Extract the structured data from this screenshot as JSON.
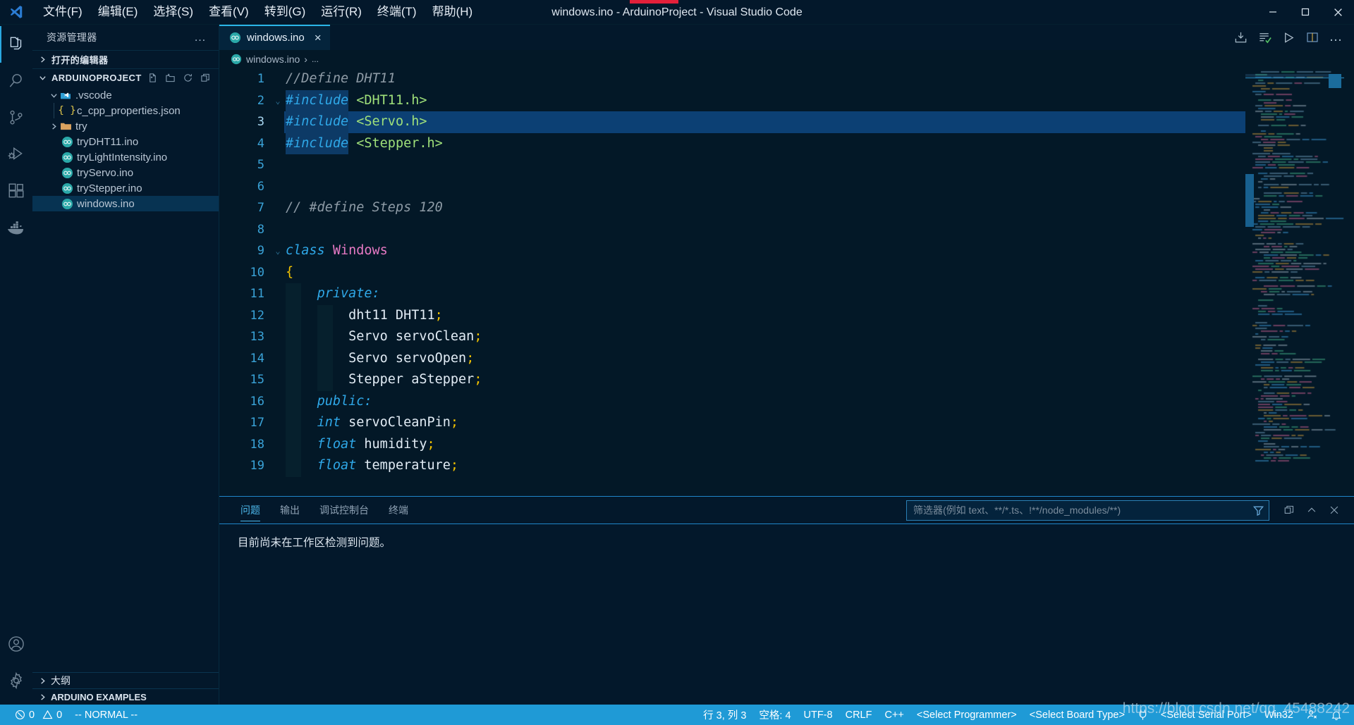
{
  "titlebar": {
    "app_title": "windows.ino - ArduinoProject - Visual Studio Code",
    "menu": [
      {
        "label": "文件(F)",
        "name": "menu-file"
      },
      {
        "label": "编辑(E)",
        "name": "menu-edit"
      },
      {
        "label": "选择(S)",
        "name": "menu-selection"
      },
      {
        "label": "查看(V)",
        "name": "menu-view"
      },
      {
        "label": "转到(G)",
        "name": "menu-go"
      },
      {
        "label": "运行(R)",
        "name": "menu-run"
      },
      {
        "label": "终端(T)",
        "name": "menu-terminal"
      },
      {
        "label": "帮助(H)",
        "name": "menu-help"
      }
    ],
    "window_controls": {
      "minimize": "minimize-icon",
      "maximize": "maximize-icon",
      "close": "close-icon"
    }
  },
  "activitybar": {
    "items": [
      {
        "name": "activity-explorer",
        "icon": "files-icon",
        "active": true
      },
      {
        "name": "activity-search",
        "icon": "search-icon",
        "active": false
      },
      {
        "name": "activity-source-control",
        "icon": "source-control-icon",
        "active": false
      },
      {
        "name": "activity-run-debug",
        "icon": "run-and-debug-icon",
        "active": false
      },
      {
        "name": "activity-extensions",
        "icon": "extensions-icon",
        "active": false
      },
      {
        "name": "activity-docker",
        "icon": "docker-whale-icon",
        "active": false
      }
    ],
    "bottom": [
      {
        "name": "activity-account",
        "icon": "account-icon"
      },
      {
        "name": "activity-settings",
        "icon": "gear-icon"
      }
    ]
  },
  "sidebar": {
    "title": "资源管理器",
    "more_actions": "…",
    "open_editors": {
      "label": "打开的编辑器",
      "expanded": false
    },
    "project": {
      "label": "ARDUINOPROJECT",
      "expanded": true,
      "actions": [
        "new-file-icon",
        "new-folder-icon",
        "refresh-icon",
        "collapse-all-icon"
      ]
    },
    "tree": [
      {
        "label": ".vscode",
        "icon": "vscode-folder-icon",
        "depth": 1,
        "expanded": true,
        "type": "folder",
        "selected": false
      },
      {
        "label": "c_cpp_properties.json",
        "icon": "json-icon",
        "depth": 2,
        "type": "file",
        "selected": false
      },
      {
        "label": "try",
        "icon": "folder-icon",
        "depth": 1,
        "expanded": false,
        "type": "folder",
        "selected": false
      },
      {
        "label": "tryDHT11.ino",
        "icon": "arduino-icon",
        "depth": 2,
        "type": "file",
        "selected": false
      },
      {
        "label": "tryLightIntensity.ino",
        "icon": "arduino-icon",
        "depth": 2,
        "type": "file",
        "selected": false
      },
      {
        "label": "tryServo.ino",
        "icon": "arduino-icon",
        "depth": 2,
        "type": "file",
        "selected": false
      },
      {
        "label": "tryStepper.ino",
        "icon": "arduino-icon",
        "depth": 2,
        "type": "file",
        "selected": false
      },
      {
        "label": "windows.ino",
        "icon": "arduino-icon",
        "depth": 2,
        "type": "file",
        "selected": true
      }
    ],
    "outline": {
      "label": "大纲",
      "expanded": false
    },
    "arduino_examples": {
      "label": "ARDUINO EXAMPLES",
      "expanded": false
    }
  },
  "editor": {
    "tabs": [
      {
        "label": "windows.ino",
        "icon": "arduino-icon",
        "active": true,
        "close": "×"
      }
    ],
    "toolbar": [
      {
        "name": "arduino-verify-upload-icon",
        "title": "Upload"
      },
      {
        "name": "arduino-verify-icon",
        "title": "Verify"
      },
      {
        "name": "run-icon",
        "title": "Run"
      },
      {
        "name": "split-editor-icon",
        "title": "Split Editor"
      },
      {
        "name": "more-actions-icon",
        "title": "More Actions..."
      }
    ],
    "breadcrumb": {
      "file": "windows.ino",
      "separator": "›",
      "rest": "..."
    },
    "cursor_line": 3,
    "lines": [
      {
        "n": 1,
        "tokens": [
          {
            "t": "//Define DHT11",
            "c": "c-comment"
          }
        ]
      },
      {
        "n": 2,
        "tokens": [
          {
            "t": "#include",
            "c": "c-keyword"
          },
          {
            "t": " ",
            "c": "c-id"
          },
          {
            "t": "<DHT11.h>",
            "c": "c-string"
          }
        ],
        "folded": true
      },
      {
        "n": 3,
        "tokens": [
          {
            "t": "#include",
            "c": "c-keyword"
          },
          {
            "t": " ",
            "c": "c-id"
          },
          {
            "t": "<Servo.h>",
            "c": "c-string"
          }
        ],
        "highlight": true
      },
      {
        "n": 4,
        "tokens": [
          {
            "t": "#include",
            "c": "c-keyword"
          },
          {
            "t": " ",
            "c": "c-id"
          },
          {
            "t": "<Stepper.h>",
            "c": "c-string"
          }
        ]
      },
      {
        "n": 5,
        "tokens": []
      },
      {
        "n": 6,
        "tokens": []
      },
      {
        "n": 7,
        "tokens": [
          {
            "t": "// #define Steps 120",
            "c": "c-comment"
          }
        ]
      },
      {
        "n": 8,
        "tokens": []
      },
      {
        "n": 9,
        "tokens": [
          {
            "t": "class",
            "c": "c-keyword"
          },
          {
            "t": " ",
            "c": "c-id"
          },
          {
            "t": "Windows",
            "c": "c-class"
          }
        ],
        "folded": true
      },
      {
        "n": 10,
        "tokens": [
          {
            "t": "{",
            "c": "c-brace"
          }
        ]
      },
      {
        "n": 11,
        "tokens": [
          {
            "t": "    ",
            "c": "c-id"
          },
          {
            "t": "private:",
            "c": "c-keyword"
          }
        ]
      },
      {
        "n": 12,
        "tokens": [
          {
            "t": "        dht11 DHT11",
            "c": "c-id"
          },
          {
            "t": ";",
            "c": "c-semi"
          }
        ]
      },
      {
        "n": 13,
        "tokens": [
          {
            "t": "        Servo servoClean",
            "c": "c-id"
          },
          {
            "t": ";",
            "c": "c-semi"
          }
        ]
      },
      {
        "n": 14,
        "tokens": [
          {
            "t": "        Servo servoOpen",
            "c": "c-id"
          },
          {
            "t": ";",
            "c": "c-semi"
          }
        ]
      },
      {
        "n": 15,
        "tokens": [
          {
            "t": "        Stepper aStepper",
            "c": "c-id"
          },
          {
            "t": ";",
            "c": "c-semi"
          }
        ]
      },
      {
        "n": 16,
        "tokens": [
          {
            "t": "    ",
            "c": "c-id"
          },
          {
            "t": "public:",
            "c": "c-keyword"
          }
        ]
      },
      {
        "n": 17,
        "tokens": [
          {
            "t": "    ",
            "c": "c-id"
          },
          {
            "t": "int",
            "c": "c-keyword"
          },
          {
            "t": " servoCleanPin",
            "c": "c-id"
          },
          {
            "t": ";",
            "c": "c-semi"
          }
        ]
      },
      {
        "n": 18,
        "tokens": [
          {
            "t": "    ",
            "c": "c-id"
          },
          {
            "t": "float",
            "c": "c-keyword"
          },
          {
            "t": " humidity",
            "c": "c-id"
          },
          {
            "t": ";",
            "c": "c-semi"
          }
        ]
      },
      {
        "n": 19,
        "tokens": [
          {
            "t": "    ",
            "c": "c-id"
          },
          {
            "t": "float",
            "c": "c-keyword"
          },
          {
            "t": " temperature",
            "c": "c-id"
          },
          {
            "t": ";",
            "c": "c-semi"
          }
        ]
      }
    ]
  },
  "panel": {
    "tabs": [
      {
        "label": "问题",
        "name": "panel-tab-problems",
        "active": true
      },
      {
        "label": "输出",
        "name": "panel-tab-output",
        "active": false
      },
      {
        "label": "调试控制台",
        "name": "panel-tab-debug-console",
        "active": false
      },
      {
        "label": "终端",
        "name": "panel-tab-terminal",
        "active": false
      }
    ],
    "filter_placeholder": "筛选器(例如 text、**/*.ts、!**/node_modules/**)",
    "filter_value": "",
    "actions": [
      {
        "name": "filter-icon"
      },
      {
        "name": "maximize-panel-icon"
      },
      {
        "name": "chevron-up-icon"
      },
      {
        "name": "close-panel-icon"
      }
    ],
    "message": "目前尚未在工作区检测到问题。"
  },
  "statusbar": {
    "errors": "0",
    "warnings": "0",
    "mode": "-- NORMAL --",
    "cursor_position": "行 3, 列 3",
    "indentation": "空格: 4",
    "encoding": "UTF-8",
    "eol": "CRLF",
    "language": "C++",
    "programmer": "<Select Programmer>",
    "board": "<Select Board Type>",
    "serial_port": "<Select Serial Port>",
    "platform": "Win32",
    "accent_color": "#1f9ad6"
  },
  "watermark": "https://blog.csdn.net/qq_45488242"
}
